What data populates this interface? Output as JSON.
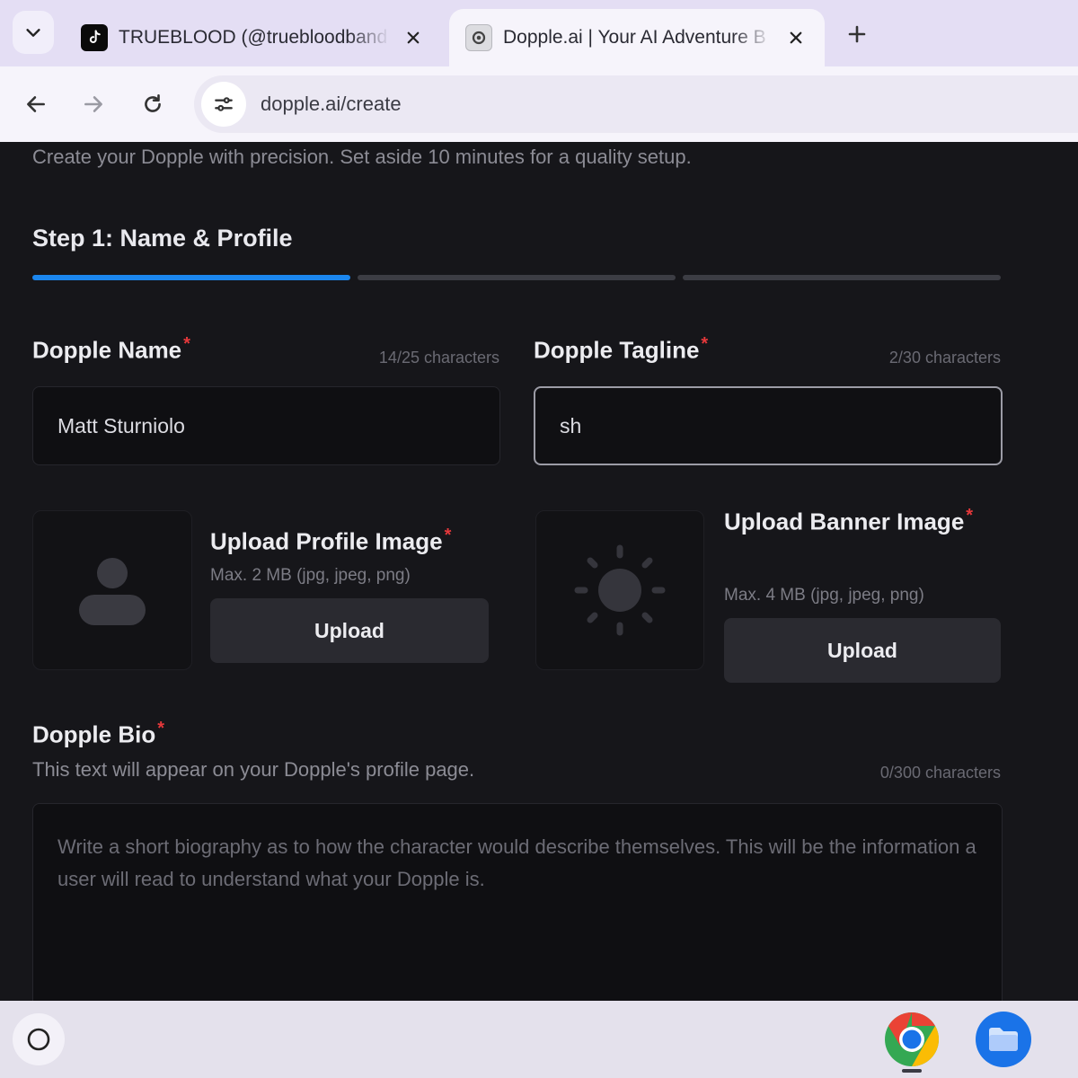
{
  "browser": {
    "tabs": [
      {
        "title": "TRUEBLOOD (@truebloodband",
        "favicon": "tiktok-icon",
        "active": false
      },
      {
        "title": "Dopple.ai | Your AI Adventure B",
        "favicon": "dopple-icon",
        "active": true
      }
    ],
    "url": "dopple.ai/create"
  },
  "page": {
    "intro": "Create your Dopple with precision. Set aside 10 minutes for a quality setup.",
    "step_title": "Step 1: Name & Profile",
    "step_progress": {
      "current": 1,
      "total": 3
    },
    "required_mark": "*",
    "name": {
      "label": "Dopple Name",
      "counter": "14/25 characters",
      "value": "Matt Sturniolo"
    },
    "tagline": {
      "label": "Dopple Tagline",
      "counter": "2/30 characters",
      "value": "sh"
    },
    "profile_image": {
      "title": "Upload Profile Image",
      "hint": "Max. 2 MB (jpg, jpeg, png)",
      "button": "Upload"
    },
    "banner_image": {
      "title": "Upload Banner Image",
      "hint": "Max. 4 MB (jpg, jpeg, png)",
      "button": "Upload"
    },
    "bio": {
      "label": "Dopple Bio",
      "description": "This text will appear on your Dopple's profile page.",
      "counter": "0/300 characters",
      "placeholder": "Write a short biography as to how the character would describe themselves. This will be the information a user will read to understand what your Dopple is."
    }
  },
  "colors": {
    "accent": "#1b86ee",
    "required": "#e5383b",
    "page_bg": "#16161a"
  }
}
